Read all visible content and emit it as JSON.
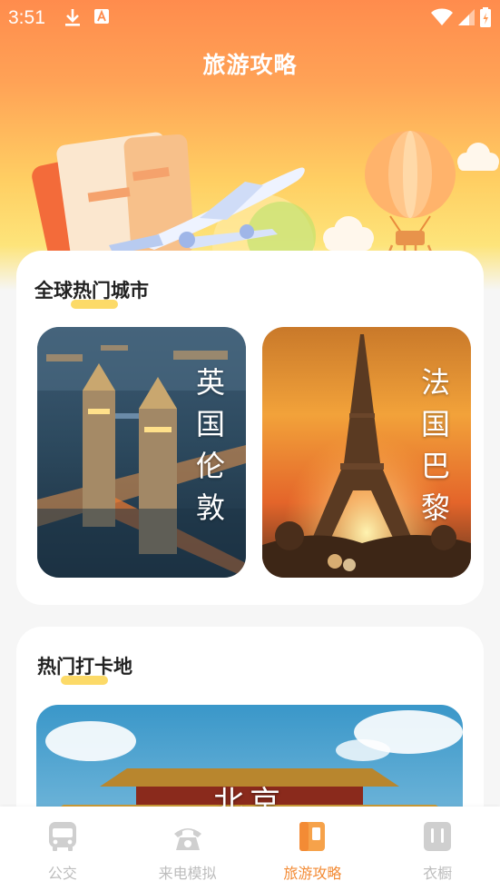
{
  "status_bar": {
    "time": "3:51"
  },
  "header": {
    "title": "旅游攻略"
  },
  "cities_section": {
    "title": "全球热门城市",
    "cities": [
      {
        "name": "英国伦敦"
      },
      {
        "name": "法国巴黎"
      }
    ]
  },
  "spots_section": {
    "title": "热门打卡地",
    "spots": [
      {
        "name": "北京"
      }
    ]
  },
  "bottom_nav": {
    "items": [
      {
        "label": "公交",
        "icon": "bus-icon",
        "active": false
      },
      {
        "label": "来电模拟",
        "icon": "phone-icon",
        "active": false
      },
      {
        "label": "旅游攻略",
        "icon": "guide-book-icon",
        "active": true
      },
      {
        "label": "衣橱",
        "icon": "wardrobe-icon",
        "active": false
      }
    ]
  },
  "colors": {
    "accent": "#f38b35",
    "inactive": "#bdbdbd",
    "header_top": "#ff8c4d",
    "header_bottom": "#fde47a"
  }
}
